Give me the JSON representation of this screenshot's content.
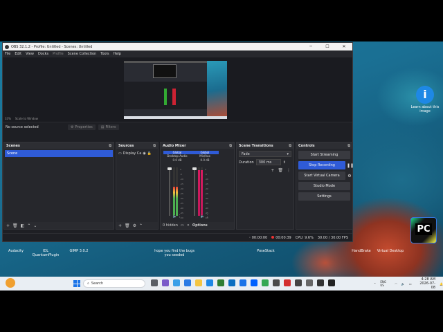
{
  "window": {
    "title": "OBS 32.1.2 - Profile: Untitled - Scenes: Untitled",
    "controls": [
      "─",
      "☐",
      "✕"
    ]
  },
  "menu": [
    "File",
    "Edit",
    "View",
    "Docks",
    "Profile",
    "Scene Collection",
    "Tools",
    "Help"
  ],
  "preview": {
    "zoom": "33%",
    "scale_mode": "Scale to Window"
  },
  "toolbar": {
    "no_source": "No source selected",
    "properties": "Properties",
    "filters": "Filters"
  },
  "scenes": {
    "title": "Scenes",
    "items": [
      "Scene"
    ]
  },
  "sources": {
    "title": "Sources",
    "items": [
      "Display Ca"
    ]
  },
  "mixer": {
    "title": "Audio Mixer",
    "channels": [
      {
        "label": "Global",
        "name": "Desktop Audio",
        "db": "0.0 dB",
        "level": 0.6
      },
      {
        "label": "Global",
        "name": "Mic/Aux",
        "db": "0.0 dB",
        "level": 0.95
      }
    ],
    "hidden": "0 hidden",
    "options": "Options",
    "ticks": [
      "0",
      "-5",
      "-10",
      "-15",
      "-20",
      "-25",
      "-30",
      "-35",
      "-40",
      "-45",
      "-50"
    ]
  },
  "transitions": {
    "title": "Scene Transitions",
    "selected": "Fade",
    "duration_label": "Duration",
    "duration": "300 ms"
  },
  "controls": {
    "title": "Controls",
    "start_streaming": "Start Streaming",
    "stop_recording": "Stop Recording",
    "start_virtual_camera": "Start Virtual Camera",
    "studio_mode": "Studio Mode",
    "settings": "Settings"
  },
  "status": {
    "stream_time": "00:00:00",
    "rec_time": "00:00:39",
    "cpu": "CPU: 9.6%",
    "fps": "30.00 / 30.00 FPS"
  },
  "desktop": {
    "learn_label": "Learn about this image",
    "pc_label": "PyCharm"
  },
  "desktop_row": [
    "Audacity",
    "IDL QuantumPlugin",
    "GIMP 3.0.2",
    "hope you find the bugs you seeded",
    "PoseStack",
    "HandBrake",
    "Virtual Desktop"
  ],
  "taskbar": {
    "search_placeholder": "Search",
    "lang": "ENG US",
    "time": "4:28 AM",
    "date": "2026-07-08"
  },
  "colors": {
    "accent": "#2f5bd7",
    "obs_bg": "#1e1f24",
    "record_red": "#e33"
  }
}
